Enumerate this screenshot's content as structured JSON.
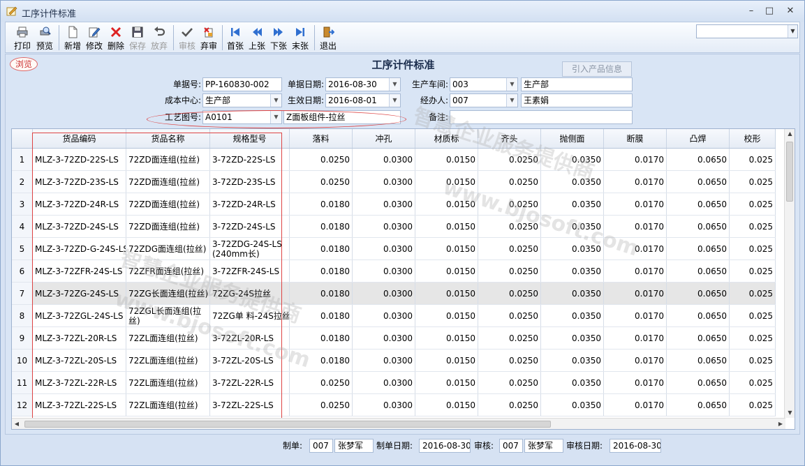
{
  "window": {
    "title": "工序计件标准",
    "controls": [
      "–",
      "□",
      "✕"
    ]
  },
  "toolbar": {
    "buttons": [
      {
        "id": "print",
        "label": "打印",
        "icon": "printer-icon",
        "enabled": true
      },
      {
        "id": "preview",
        "label": "预览",
        "icon": "print-preview-icon",
        "enabled": true
      },
      {
        "id": "new",
        "label": "新增",
        "icon": "new-document-icon",
        "enabled": true
      },
      {
        "id": "edit",
        "label": "修改",
        "icon": "edit-icon",
        "enabled": true
      },
      {
        "id": "delete",
        "label": "删除",
        "icon": "delete-x-icon",
        "enabled": true
      },
      {
        "id": "save",
        "label": "保存",
        "icon": "floppy-disk-icon",
        "enabled": false
      },
      {
        "id": "discard",
        "label": "放弃",
        "icon": "undo-icon",
        "enabled": false
      },
      {
        "id": "audit",
        "label": "审核",
        "icon": "checkmark-icon",
        "enabled": false
      },
      {
        "id": "unaudit",
        "label": "弃审",
        "icon": "unaudit-icon",
        "enabled": true
      },
      {
        "id": "first",
        "label": "首张",
        "icon": "first-record-icon",
        "enabled": true
      },
      {
        "id": "prev",
        "label": "上张",
        "icon": "previous-record-icon",
        "enabled": true
      },
      {
        "id": "next",
        "label": "下张",
        "icon": "next-record-icon",
        "enabled": true
      },
      {
        "id": "last",
        "label": "末张",
        "icon": "last-record-icon",
        "enabled": true
      },
      {
        "id": "exit",
        "label": "退出",
        "icon": "exit-door-icon",
        "enabled": true
      }
    ],
    "search_value": ""
  },
  "form": {
    "mode_stamp": "浏览",
    "title": "工序计件标准",
    "import_button": "引入产品信息",
    "fields": {
      "doc_no": {
        "label": "单据号:",
        "value": "PP-160830-002"
      },
      "doc_date": {
        "label": "单据日期:",
        "value": "2016-08-30"
      },
      "workshop": {
        "label": "生产车间:",
        "code": "003",
        "name": "生产部"
      },
      "cost_center": {
        "label": "成本中心:",
        "value": "生产部"
      },
      "effective_date": {
        "label": "生效日期:",
        "value": "2016-08-01"
      },
      "handler": {
        "label": "经办人:",
        "code": "007",
        "name": "王素娟"
      },
      "drawing_no": {
        "label": "工艺图号:",
        "code": "A0101",
        "name": "Z面板组件-拉丝"
      },
      "remark": {
        "label": "备注:",
        "value": ""
      }
    }
  },
  "grid": {
    "columns": [
      "",
      "货品编码",
      "货品名称",
      "规格型号",
      "落料",
      "冲孔",
      "材质标",
      "齐头",
      "抛侧面",
      "断膜",
      "凸焊",
      "校形"
    ],
    "rows": [
      [
        "1",
        "MLZ-3-72ZD-22S-LS",
        "72ZD面连组(拉丝)",
        "3-72ZD-22S-LS",
        "0.0250",
        "0.0300",
        "0.0150",
        "0.0250",
        "0.0350",
        "0.0170",
        "0.0650",
        "0.025"
      ],
      [
        "2",
        "MLZ-3-72ZD-23S-LS",
        "72ZD面连组(拉丝)",
        "3-72ZD-23S-LS",
        "0.0250",
        "0.0300",
        "0.0150",
        "0.0250",
        "0.0350",
        "0.0170",
        "0.0650",
        "0.025"
      ],
      [
        "3",
        "MLZ-3-72ZD-24R-LS",
        "72ZD面连组(拉丝)",
        "3-72ZD-24R-LS",
        "0.0180",
        "0.0300",
        "0.0150",
        "0.0250",
        "0.0350",
        "0.0170",
        "0.0650",
        "0.025"
      ],
      [
        "4",
        "MLZ-3-72ZD-24S-LS",
        "72ZD面连组(拉丝)",
        "3-72ZD-24S-LS",
        "0.0180",
        "0.0300",
        "0.0150",
        "0.0250",
        "0.0350",
        "0.0170",
        "0.0650",
        "0.025"
      ],
      [
        "5",
        "MLZ-3-72ZD-G-24S-LS",
        "72ZDG面连组(拉丝)",
        "3-72ZDG-24S-LS (240mm长)",
        "0.0180",
        "0.0300",
        "0.0150",
        "0.0250",
        "0.0350",
        "0.0170",
        "0.0650",
        "0.025"
      ],
      [
        "6",
        "MLZ-3-72ZFR-24S-LS",
        "72ZFR面连组(拉丝)",
        "3-72ZFR-24S-LS",
        "0.0180",
        "0.0300",
        "0.0150",
        "0.0250",
        "0.0350",
        "0.0170",
        "0.0650",
        "0.025"
      ],
      [
        "7",
        "MLZ-3-72ZG-24S-LS",
        "72ZG长面连组(拉丝)",
        "72ZG-24S拉丝",
        "0.0180",
        "0.0300",
        "0.0150",
        "0.0250",
        "0.0350",
        "0.0170",
        "0.0650",
        "0.025"
      ],
      [
        "8",
        "MLZ-3-72ZGL-24S-LS",
        "72ZGL长面连组(拉丝)",
        "72ZG单 料-24S拉丝",
        "0.0180",
        "0.0300",
        "0.0150",
        "0.0250",
        "0.0350",
        "0.0170",
        "0.0650",
        "0.025"
      ],
      [
        "9",
        "MLZ-3-72ZL-20R-LS",
        "72ZL面连组(拉丝)",
        "3-72ZL-20R-LS",
        "0.0180",
        "0.0300",
        "0.0150",
        "0.0250",
        "0.0350",
        "0.0170",
        "0.0650",
        "0.025"
      ],
      [
        "10",
        "MLZ-3-72ZL-20S-LS",
        "72ZL面连组(拉丝)",
        "3-72ZL-20S-LS",
        "0.0180",
        "0.0300",
        "0.0150",
        "0.0250",
        "0.0350",
        "0.0170",
        "0.0650",
        "0.025"
      ],
      [
        "11",
        "MLZ-3-72ZL-22R-LS",
        "72ZL面连组(拉丝)",
        "3-72ZL-22R-LS",
        "0.0250",
        "0.0300",
        "0.0150",
        "0.0250",
        "0.0350",
        "0.0170",
        "0.0650",
        "0.025"
      ],
      [
        "12",
        "MLZ-3-72ZL-22S-LS",
        "72ZL面连组(拉丝)",
        "3-72ZL-22S-LS",
        "0.0250",
        "0.0300",
        "0.0150",
        "0.0250",
        "0.0350",
        "0.0170",
        "0.0650",
        "0.025"
      ]
    ],
    "selected_row_index": 6
  },
  "footer": {
    "maker_label": "制单:",
    "maker_code": "007",
    "maker_name": "张梦军",
    "make_date_label": "制单日期:",
    "make_date": "2016-08-30",
    "auditor_label": "审核:",
    "auditor_code": "007",
    "auditor_name": "张梦军",
    "audit_date_label": "审核日期:",
    "audit_date": "2016-08-30"
  },
  "watermarks": [
    "智慧企业服务提供商",
    "www.bjosoft.com"
  ],
  "colors": {
    "accent": "#d44444",
    "header_bg": "#d6e2f3"
  }
}
